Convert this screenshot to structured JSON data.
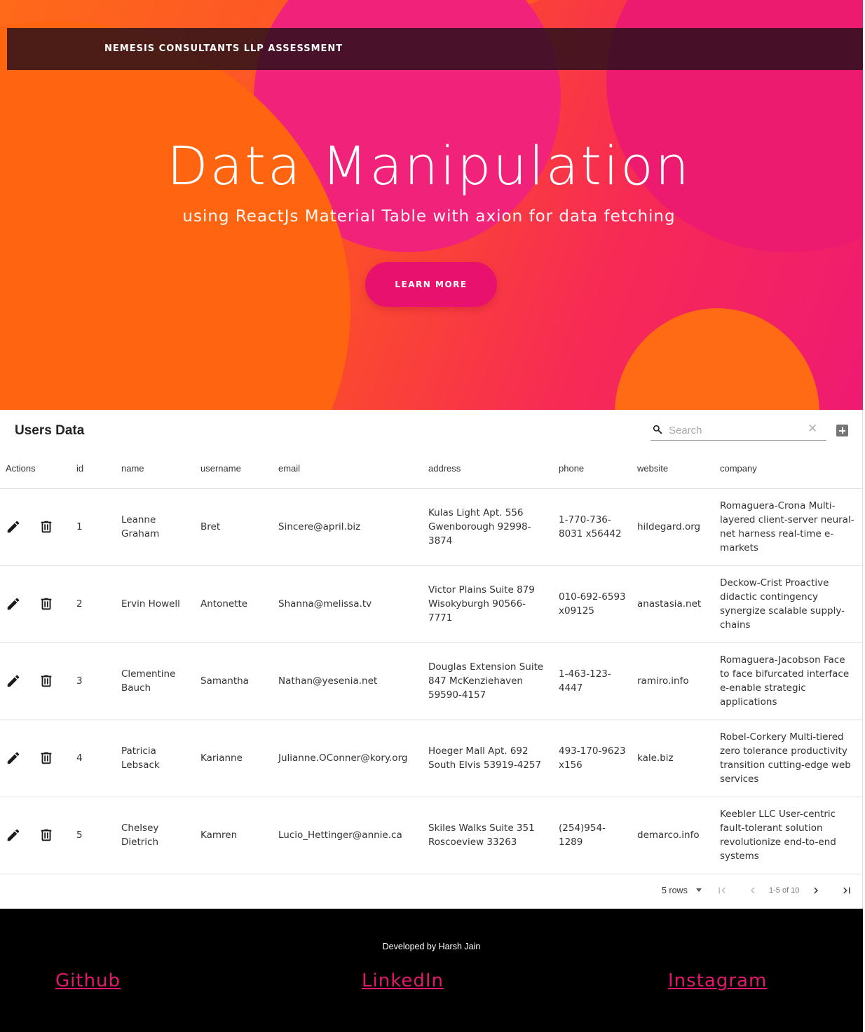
{
  "navbar": {
    "brand": "NEMESIS CONSULTANTS LLP ASSESSMENT"
  },
  "hero": {
    "title": "Data Manipulation",
    "subtitle": "using ReactJs Material Table with axion for data fetching",
    "cta_label": "LEARN MORE"
  },
  "table": {
    "title": "Users Data",
    "search": {
      "placeholder": "Search",
      "value": ""
    },
    "columns": [
      "Actions",
      "id",
      "name",
      "username",
      "email",
      "address",
      "phone",
      "website",
      "company"
    ],
    "rows": [
      {
        "id": "1",
        "name": "Leanne Graham",
        "username": "Bret",
        "email": "Sincere@april.biz",
        "address": "Kulas Light Apt. 556 Gwenborough 92998-3874",
        "phone": "1-770-736-8031 x56442",
        "website": "hildegard.org",
        "company": "Romaguera-Crona Multi-layered client-server neural-net harness real-time e-markets"
      },
      {
        "id": "2",
        "name": "Ervin Howell",
        "username": "Antonette",
        "email": "Shanna@melissa.tv",
        "address": "Victor Plains Suite 879 Wisokyburgh 90566-7771",
        "phone": "010-692-6593 x09125",
        "website": "anastasia.net",
        "company": "Deckow-Crist Proactive didactic contingency synergize scalable supply-chains"
      },
      {
        "id": "3",
        "name": "Clementine Bauch",
        "username": "Samantha",
        "email": "Nathan@yesenia.net",
        "address": "Douglas Extension Suite 847 McKenziehaven 59590-4157",
        "phone": "1-463-123-4447",
        "website": "ramiro.info",
        "company": "Romaguera-Jacobson Face to face bifurcated interface e-enable strategic applications"
      },
      {
        "id": "4",
        "name": "Patricia Lebsack",
        "username": "Karianne",
        "email": "Julianne.OConner@kory.org",
        "address": "Hoeger Mall Apt. 692 South Elvis 53919-4257",
        "phone": "493-170-9623 x156",
        "website": "kale.biz",
        "company": "Robel-Corkery Multi-tiered zero tolerance productivity transition cutting-edge web services"
      },
      {
        "id": "5",
        "name": "Chelsey Dietrich",
        "username": "Kamren",
        "email": "Lucio_Hettinger@annie.ca",
        "address": "Skiles Walks Suite 351 Roscoeview 33263",
        "phone": "(254)954-1289",
        "website": "demarco.info",
        "company": "Keebler LLC User-centric fault-tolerant solution revolutionize end-to-end systems"
      }
    ],
    "pagination": {
      "rows_label": "5 rows",
      "range_label": "1-5 of 10"
    }
  },
  "footer": {
    "credit": "Developed by Harsh Jain",
    "links": {
      "github": "Github",
      "linkedin": "LinkedIn",
      "instagram": "Instagram"
    }
  },
  "colors": {
    "accent": "#e8126e",
    "hero_orange": "#ff6510",
    "hero_pink": "#ec1b6f",
    "footer_bg": "#000000",
    "link": "#e0186e"
  },
  "icons": [
    "search-icon",
    "clear-icon",
    "add-icon",
    "edit-icon",
    "delete-icon",
    "dropdown-caret-icon",
    "first-page-icon",
    "previous-page-icon",
    "next-page-icon",
    "last-page-icon"
  ]
}
